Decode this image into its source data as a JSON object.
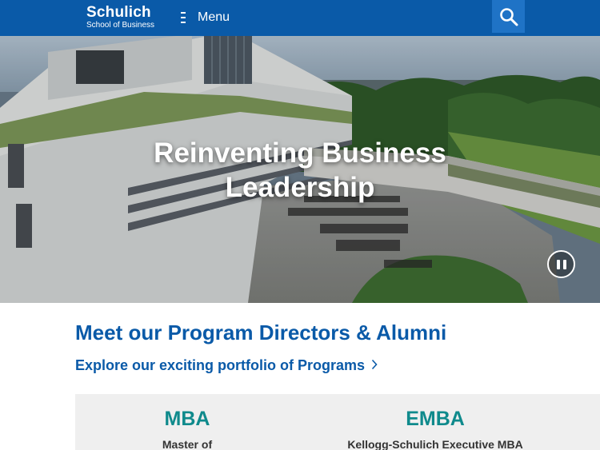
{
  "header": {
    "logo_name": "Schulich",
    "logo_sub": "School of Business",
    "menu_label": "Menu",
    "search_icon": "search-icon",
    "menu_icon": "hamburger-menu-icon",
    "brand_color": "#0a5aa8"
  },
  "hero": {
    "title_line1": "Reinventing Business",
    "title_line2": "Leadership",
    "pause_icon": "pause-icon"
  },
  "main": {
    "section_title": "Meet our Program Directors & Alumni",
    "programs_link": "Explore our exciting portfolio of Programs",
    "programs": [
      {
        "code": "MBA",
        "desc": "Master of"
      },
      {
        "code": "EMBA",
        "desc": "Kellogg-Schulich Executive MBA"
      }
    ],
    "accent_color": "#0f8a8c"
  }
}
